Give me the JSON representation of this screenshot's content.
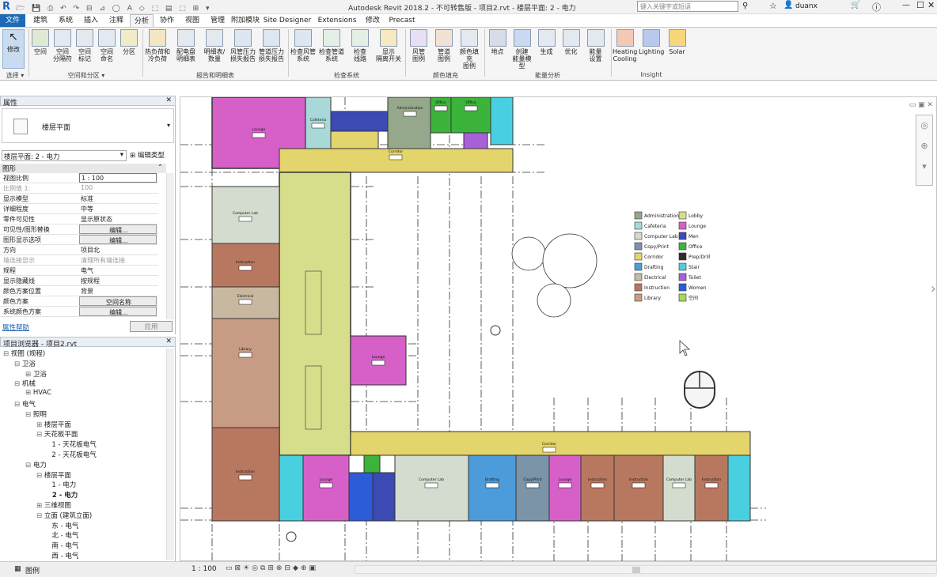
{
  "window": {
    "title": "Autodesk Revit 2018.2 - 不可转售版 -   项目2.rvt - 楼层平面: 2 - 电力",
    "search_placeholder": "键入关键字或短语",
    "user": "duanx"
  },
  "menu": {
    "file": "文件",
    "tabs": [
      "建筑",
      "系统",
      "插入",
      "注释",
      "分析",
      "协作",
      "视图",
      "管理",
      "附加模块",
      "Site Designer",
      "Extensions",
      "修改",
      "Precast"
    ],
    "active": "分析"
  },
  "ribbon": {
    "modify": "修改",
    "select": "选择 ▾",
    "space_tools": [
      "空间",
      "空间\n分隔符",
      "空间\n标记",
      "空间\n命名",
      "分区"
    ],
    "space_group": "空间和分区 ▾",
    "report_tools": [
      "热负荷和\n冷负荷",
      "配电盘\n明细表",
      "明细表/\n数量",
      "风管压力\n损失报告",
      "管道压力\n损失报告"
    ],
    "report_group": "报告和明细表",
    "check_tools": [
      "检查风管\n系统",
      "检查管道\n系统",
      "检查\n线路",
      "显示\n隔离开关"
    ],
    "check_group": "检查系统",
    "color_tools": [
      "风管\n图例",
      "管道\n图例",
      "颜色填充\n图例"
    ],
    "color_group": "颜色填充",
    "energy_tools": [
      "地点",
      "创建\n能量模型",
      "生成",
      "优化",
      "能量\n设置"
    ],
    "energy_group": "能量分析",
    "insight_tools": [
      "Heating\nCooling",
      "Lighting",
      "Solar"
    ],
    "insight_group": "Insight"
  },
  "properties": {
    "title": "属性",
    "type_name": "楼层平面",
    "instance": "楼层平面: 2 - 电力",
    "edit_type": "编辑类型",
    "section": "图形",
    "rows": [
      {
        "k": "视图比例",
        "v": "1 : 100"
      },
      {
        "k": "比例值 1:",
        "v": "100"
      },
      {
        "k": "显示模型",
        "v": "标准"
      },
      {
        "k": "详细程度",
        "v": "中等"
      },
      {
        "k": "零件可见性",
        "v": "显示原状态"
      },
      {
        "k": "可见性/图形替换",
        "v": "编辑..."
      },
      {
        "k": "图形显示选项",
        "v": "编辑..."
      },
      {
        "k": "方向",
        "v": "项目北"
      },
      {
        "k": "墙连接显示",
        "v": "清理所有墙连接"
      },
      {
        "k": "规程",
        "v": "电气"
      },
      {
        "k": "显示隐藏线",
        "v": "按规程"
      },
      {
        "k": "颜色方案位置",
        "v": "背景"
      },
      {
        "k": "颜色方案",
        "v": "空间名称"
      },
      {
        "k": "系统颜色方案",
        "v": "编辑..."
      }
    ],
    "help": "属性帮助",
    "apply": "应用"
  },
  "browser": {
    "title": "项目浏览器 - 项目2.rvt",
    "items": [
      {
        "t": "视图 (规程)",
        "d": 0,
        "s": "⊟"
      },
      {
        "t": "卫浴",
        "d": 1,
        "s": "⊟"
      },
      {
        "t": "卫浴",
        "d": 2,
        "s": "⊞"
      },
      {
        "t": "机械",
        "d": 1,
        "s": "⊟"
      },
      {
        "t": "HVAC",
        "d": 2,
        "s": "⊞"
      },
      {
        "t": "电气",
        "d": 1,
        "s": "⊟"
      },
      {
        "t": "照明",
        "d": 2,
        "s": "⊟"
      },
      {
        "t": "楼层平面",
        "d": 3,
        "s": "⊞"
      },
      {
        "t": "天花板平面",
        "d": 3,
        "s": "⊟"
      },
      {
        "t": "1 - 天花板电气",
        "d": 4,
        "s": ""
      },
      {
        "t": "2 - 天花板电气",
        "d": 4,
        "s": ""
      },
      {
        "t": "电力",
        "d": 2,
        "s": "⊟"
      },
      {
        "t": "楼层平面",
        "d": 3,
        "s": "⊟"
      },
      {
        "t": "1 - 电力",
        "d": 4,
        "s": ""
      },
      {
        "t": "2 - 电力",
        "d": 4,
        "s": "",
        "b": true
      },
      {
        "t": "三维视图",
        "d": 3,
        "s": "⊞"
      },
      {
        "t": "立面 (建筑立面)",
        "d": 3,
        "s": "⊟"
      },
      {
        "t": "东 - 电气",
        "d": 4,
        "s": ""
      },
      {
        "t": "北 - 电气",
        "d": 4,
        "s": ""
      },
      {
        "t": "南 - 电气",
        "d": 4,
        "s": ""
      },
      {
        "t": "西 - 电气",
        "d": 4,
        "s": ""
      },
      {
        "t": "图例",
        "d": 0,
        "s": "⊞"
      }
    ]
  },
  "legend": [
    {
      "n": "Administration",
      "c": "#96a88c"
    },
    {
      "n": "Lobby",
      "c": "#d6de8c"
    },
    {
      "n": "Cafeteria",
      "c": "#a8d8d8"
    },
    {
      "n": "Lounge",
      "c": "#d660c8"
    },
    {
      "n": "Computer Lab",
      "c": "#d4dcd0"
    },
    {
      "n": "Men",
      "c": "#3c4ab4"
    },
    {
      "n": "Copy/Print",
      "c": "#7c94a8"
    },
    {
      "n": "Office",
      "c": "#3cb43c"
    },
    {
      "n": "Corridor",
      "c": "#e4d46c"
    },
    {
      "n": "Prep/Drill",
      "c": "#2c2c2c"
    },
    {
      "n": "Drafting",
      "c": "#4c9cdc"
    },
    {
      "n": "Stair",
      "c": "#48d0e0"
    },
    {
      "n": "Electrical",
      "c": "#c8b8a0"
    },
    {
      "n": "Toilet",
      "c": "#a860d8"
    },
    {
      "n": "Instruction",
      "c": "#b87860"
    },
    {
      "n": "Women",
      "c": "#2c5cd8"
    },
    {
      "n": "Library",
      "c": "#c89c84"
    },
    {
      "n": "空间",
      "c": "#a8d858"
    }
  ],
  "rooms": [
    {
      "n": "Lounge",
      "c": "#d660c8"
    },
    {
      "n": "Cafeteria",
      "c": "#a8d8d8"
    },
    {
      "n": "Administration",
      "c": "#96a88c"
    },
    {
      "n": "Office",
      "c": "#3cb43c"
    },
    {
      "n": "Computer Lab",
      "c": "#d4dcd0"
    },
    {
      "n": "Instruction",
      "c": "#b87860"
    },
    {
      "n": "Electrical",
      "c": "#c8b8a0"
    },
    {
      "n": "Library",
      "c": "#c89c84"
    },
    {
      "n": "Drafting",
      "c": "#4c9cdc"
    },
    {
      "n": "Copy/Print",
      "c": "#7c94a8"
    },
    {
      "n": "Corridor",
      "c": "#e4d46c"
    },
    {
      "n": "Stair",
      "c": "#48d0e0"
    },
    {
      "n": "Men",
      "c": "#3c4ab4"
    },
    {
      "n": "Women",
      "c": "#2c5cd8"
    },
    {
      "n": "Toilet",
      "c": "#a860d8"
    },
    {
      "n": "Lobby",
      "c": "#d6de8c"
    }
  ],
  "status": {
    "scale": "1 : 100"
  }
}
